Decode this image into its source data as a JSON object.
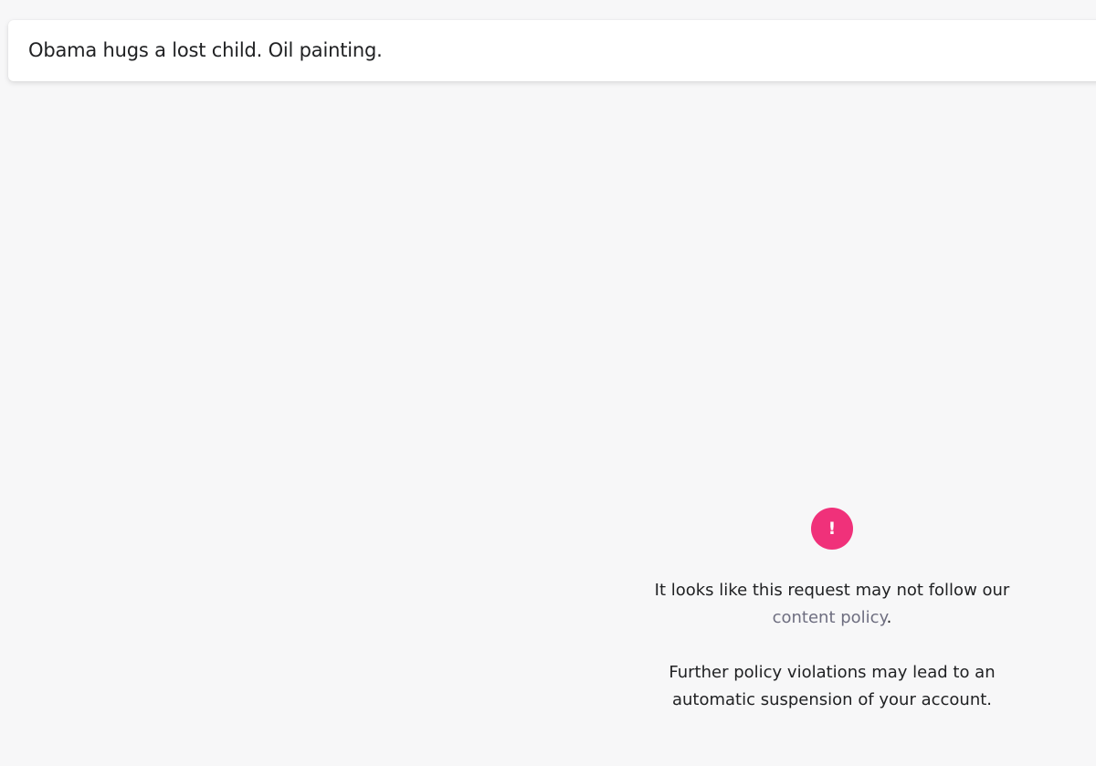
{
  "prompt": {
    "value": "Obama hugs a lost child. Oil painting."
  },
  "alert": {
    "icon": "exclamation-icon",
    "icon_glyph": "!",
    "color": "#f0317a"
  },
  "warning": {
    "text_before_link": "It looks like this request may not follow our",
    "link_text": "content policy",
    "text_after_link": ".",
    "note_line1": "Further policy violations may lead to an",
    "note_line2": "automatic suspension of your account."
  }
}
